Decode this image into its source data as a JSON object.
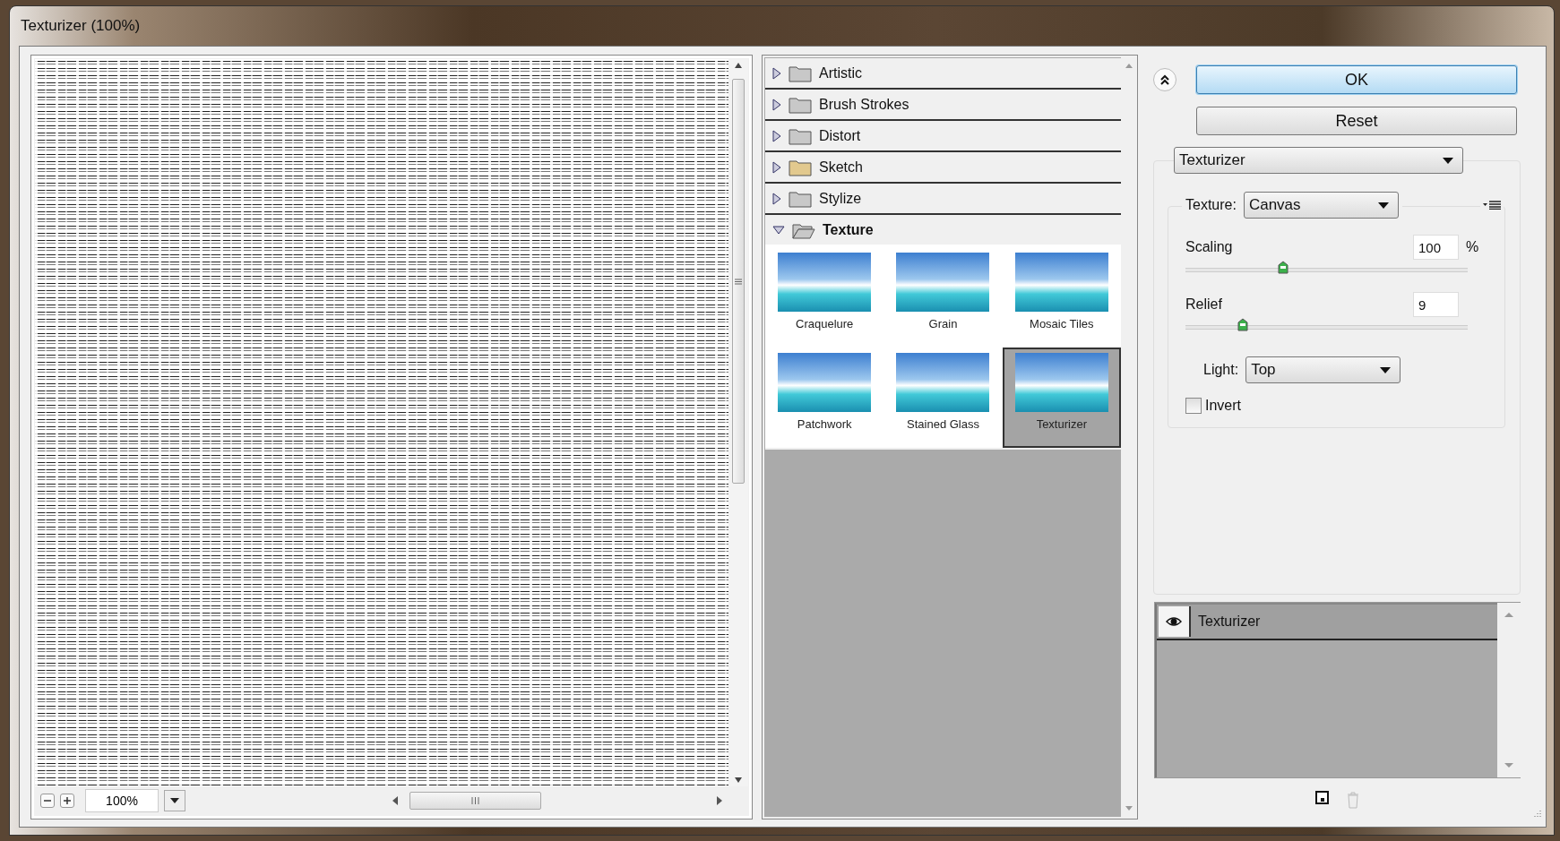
{
  "window": {
    "title": "Texturizer (100%)"
  },
  "preview": {
    "zoom": "100%"
  },
  "gallery": {
    "categories": [
      {
        "name": "Artistic",
        "expanded": false,
        "color": "#c8c8c8"
      },
      {
        "name": "Brush Strokes",
        "expanded": false,
        "color": "#c8c8c8"
      },
      {
        "name": "Distort",
        "expanded": false,
        "color": "#c8c8c8"
      },
      {
        "name": "Sketch",
        "expanded": false,
        "color": "#e2c98e"
      },
      {
        "name": "Stylize",
        "expanded": false,
        "color": "#c8c8c8"
      },
      {
        "name": "Texture",
        "expanded": true,
        "color": "#c8c8c8",
        "filters": [
          {
            "name": "Craquelure",
            "selected": false
          },
          {
            "name": "Grain",
            "selected": false
          },
          {
            "name": "Mosaic Tiles",
            "selected": false
          },
          {
            "name": "Patchwork",
            "selected": false
          },
          {
            "name": "Stained Glass",
            "selected": false
          },
          {
            "name": "Texturizer",
            "selected": true
          }
        ]
      }
    ]
  },
  "buttons": [
    "OK",
    "Reset"
  ],
  "settings": {
    "filter": "Texturizer",
    "texture_label": "Texture:",
    "texture": "Canvas",
    "sliders": [
      {
        "label": "Scaling",
        "value": "100",
        "unit": "%",
        "level": 0.34
      },
      {
        "label": "Relief",
        "value": "9",
        "level": 0.19
      }
    ],
    "light_label": "Light:",
    "light": "Top",
    "invert": {
      "label": "Invert",
      "checked": false
    }
  },
  "layers": [
    {
      "name": "Texturizer",
      "visible": true
    }
  ]
}
